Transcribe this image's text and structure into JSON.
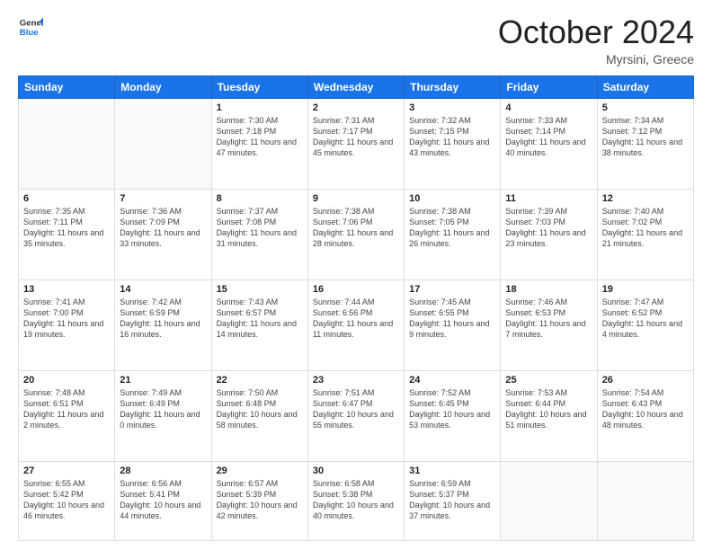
{
  "header": {
    "logo_line1": "General",
    "logo_line2": "Blue",
    "month": "October 2024",
    "location": "Myrsini, Greece"
  },
  "weekdays": [
    "Sunday",
    "Monday",
    "Tuesday",
    "Wednesday",
    "Thursday",
    "Friday",
    "Saturday"
  ],
  "weeks": [
    [
      {
        "day": "",
        "info": ""
      },
      {
        "day": "",
        "info": ""
      },
      {
        "day": "1",
        "info": "Sunrise: 7:30 AM\nSunset: 7:18 PM\nDaylight: 11 hours and 47 minutes."
      },
      {
        "day": "2",
        "info": "Sunrise: 7:31 AM\nSunset: 7:17 PM\nDaylight: 11 hours and 45 minutes."
      },
      {
        "day": "3",
        "info": "Sunrise: 7:32 AM\nSunset: 7:15 PM\nDaylight: 11 hours and 43 minutes."
      },
      {
        "day": "4",
        "info": "Sunrise: 7:33 AM\nSunset: 7:14 PM\nDaylight: 11 hours and 40 minutes."
      },
      {
        "day": "5",
        "info": "Sunrise: 7:34 AM\nSunset: 7:12 PM\nDaylight: 11 hours and 38 minutes."
      }
    ],
    [
      {
        "day": "6",
        "info": "Sunrise: 7:35 AM\nSunset: 7:11 PM\nDaylight: 11 hours and 35 minutes."
      },
      {
        "day": "7",
        "info": "Sunrise: 7:36 AM\nSunset: 7:09 PM\nDaylight: 11 hours and 33 minutes."
      },
      {
        "day": "8",
        "info": "Sunrise: 7:37 AM\nSunset: 7:08 PM\nDaylight: 11 hours and 31 minutes."
      },
      {
        "day": "9",
        "info": "Sunrise: 7:38 AM\nSunset: 7:06 PM\nDaylight: 11 hours and 28 minutes."
      },
      {
        "day": "10",
        "info": "Sunrise: 7:38 AM\nSunset: 7:05 PM\nDaylight: 11 hours and 26 minutes."
      },
      {
        "day": "11",
        "info": "Sunrise: 7:39 AM\nSunset: 7:03 PM\nDaylight: 11 hours and 23 minutes."
      },
      {
        "day": "12",
        "info": "Sunrise: 7:40 AM\nSunset: 7:02 PM\nDaylight: 11 hours and 21 minutes."
      }
    ],
    [
      {
        "day": "13",
        "info": "Sunrise: 7:41 AM\nSunset: 7:00 PM\nDaylight: 11 hours and 19 minutes."
      },
      {
        "day": "14",
        "info": "Sunrise: 7:42 AM\nSunset: 6:59 PM\nDaylight: 11 hours and 16 minutes."
      },
      {
        "day": "15",
        "info": "Sunrise: 7:43 AM\nSunset: 6:57 PM\nDaylight: 11 hours and 14 minutes."
      },
      {
        "day": "16",
        "info": "Sunrise: 7:44 AM\nSunset: 6:56 PM\nDaylight: 11 hours and 11 minutes."
      },
      {
        "day": "17",
        "info": "Sunrise: 7:45 AM\nSunset: 6:55 PM\nDaylight: 11 hours and 9 minutes."
      },
      {
        "day": "18",
        "info": "Sunrise: 7:46 AM\nSunset: 6:53 PM\nDaylight: 11 hours and 7 minutes."
      },
      {
        "day": "19",
        "info": "Sunrise: 7:47 AM\nSunset: 6:52 PM\nDaylight: 11 hours and 4 minutes."
      }
    ],
    [
      {
        "day": "20",
        "info": "Sunrise: 7:48 AM\nSunset: 6:51 PM\nDaylight: 11 hours and 2 minutes."
      },
      {
        "day": "21",
        "info": "Sunrise: 7:49 AM\nSunset: 6:49 PM\nDaylight: 11 hours and 0 minutes."
      },
      {
        "day": "22",
        "info": "Sunrise: 7:50 AM\nSunset: 6:48 PM\nDaylight: 10 hours and 58 minutes."
      },
      {
        "day": "23",
        "info": "Sunrise: 7:51 AM\nSunset: 6:47 PM\nDaylight: 10 hours and 55 minutes."
      },
      {
        "day": "24",
        "info": "Sunrise: 7:52 AM\nSunset: 6:45 PM\nDaylight: 10 hours and 53 minutes."
      },
      {
        "day": "25",
        "info": "Sunrise: 7:53 AM\nSunset: 6:44 PM\nDaylight: 10 hours and 51 minutes."
      },
      {
        "day": "26",
        "info": "Sunrise: 7:54 AM\nSunset: 6:43 PM\nDaylight: 10 hours and 48 minutes."
      }
    ],
    [
      {
        "day": "27",
        "info": "Sunrise: 6:55 AM\nSunset: 5:42 PM\nDaylight: 10 hours and 46 minutes."
      },
      {
        "day": "28",
        "info": "Sunrise: 6:56 AM\nSunset: 5:41 PM\nDaylight: 10 hours and 44 minutes."
      },
      {
        "day": "29",
        "info": "Sunrise: 6:57 AM\nSunset: 5:39 PM\nDaylight: 10 hours and 42 minutes."
      },
      {
        "day": "30",
        "info": "Sunrise: 6:58 AM\nSunset: 5:38 PM\nDaylight: 10 hours and 40 minutes."
      },
      {
        "day": "31",
        "info": "Sunrise: 6:59 AM\nSunset: 5:37 PM\nDaylight: 10 hours and 37 minutes."
      },
      {
        "day": "",
        "info": ""
      },
      {
        "day": "",
        "info": ""
      }
    ]
  ]
}
